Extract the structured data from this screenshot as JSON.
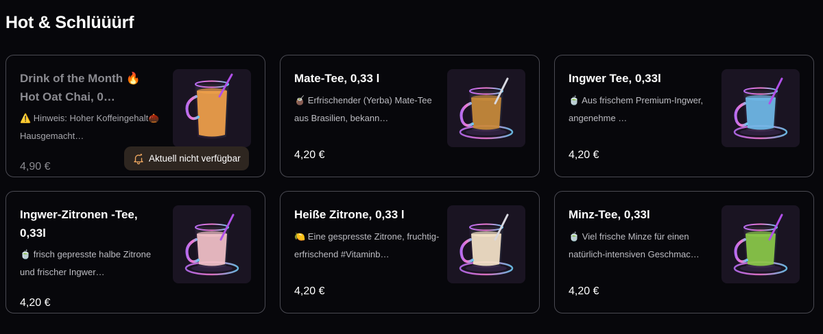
{
  "section": {
    "title": "Hot & Schlüüürf"
  },
  "items": [
    {
      "title": "Drink of the Month 🔥 Hot Oat Chai, 0…",
      "description": "⚠️ Hinweis: Hoher Koffeingehalt🌰 Hausgemacht…",
      "price": "4,90 €",
      "available": false,
      "badge": "Aktuell nicht verfügbar",
      "drink_color": "#f0a04a"
    },
    {
      "title": "Mate-Tee, 0,33 l",
      "description": "🧉 Erfrischender (Yerba) Mate-Tee aus Brasilien, bekann…",
      "price": "4,20 €",
      "available": true,
      "drink_color": "#c88a3a"
    },
    {
      "title": "Ingwer Tee, 0,33l",
      "description": "🍵 Aus frischem Premium-Ingwer, angenehme …",
      "price": "4,20 €",
      "available": true,
      "drink_color": "#6fb8e8"
    },
    {
      "title": "Ingwer-Zitronen -Tee, 0,33l",
      "description": "🍵 frisch gepresste halbe Zitrone und frischer Ingwer…",
      "price": "4,20 €",
      "available": true,
      "drink_color": "#f2c0c8"
    },
    {
      "title": "Heiße Zitrone, 0,33 l",
      "description": "🍋 Eine gespresste Zitrone, fruchtig-erfrischend #Vitaminb…",
      "price": "4,20 €",
      "available": true,
      "drink_color": "#f4e2c8"
    },
    {
      "title": "Minz-Tee, 0,33l",
      "description": "🍵 Viel frische Minze für einen natürlich-intensiven Geschmac…",
      "price": "4,20 €",
      "available": true,
      "drink_color": "#8ac848"
    }
  ]
}
